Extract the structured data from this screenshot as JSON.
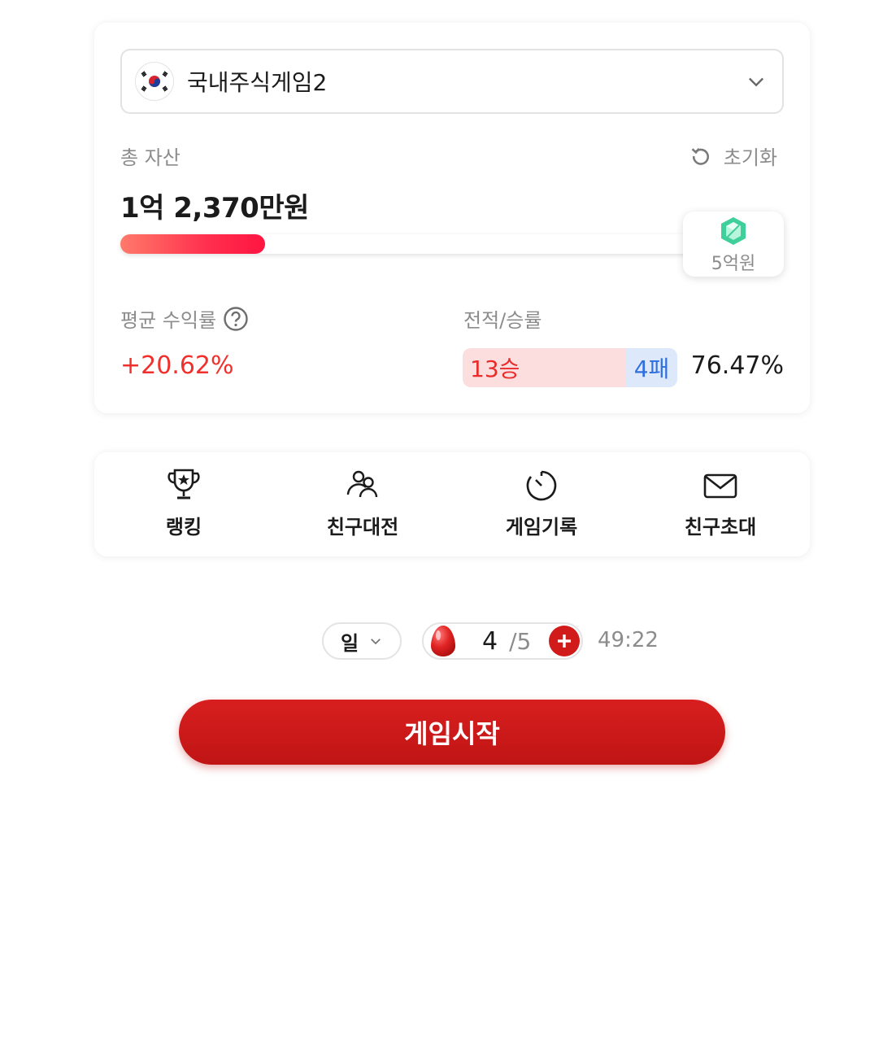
{
  "game": {
    "selected": "국내주식게임2",
    "flag_icon": "korea-flag-icon"
  },
  "assets": {
    "total_label": "총 자산",
    "reset_label": "초기화",
    "total_value": "1억 2,370만원",
    "progress_fraction": 0.2474,
    "goal_label": "5억원",
    "goal_icon": "gem-icon"
  },
  "stats": {
    "avg_label": "평균 수익률",
    "avg_value": "+20.62%",
    "record_label": "전적/승률",
    "wins": "13승",
    "losses": "4패",
    "win_rate": "76.47%"
  },
  "menu": [
    {
      "label": "랭킹",
      "icon": "trophy-icon"
    },
    {
      "label": "친구대전",
      "icon": "friends-icon"
    },
    {
      "label": "게임기록",
      "icon": "timer-icon"
    },
    {
      "label": "친구초대",
      "icon": "mail-icon"
    }
  ],
  "controls": {
    "mode": "일",
    "energy_current": "4",
    "energy_max": "/5",
    "timer": "49:22",
    "start_label": "게임시작"
  },
  "colors": {
    "accent_red": "#d11a1a",
    "win_red": "#ea2b2b",
    "loss_blue": "#2f6fde",
    "profit_red": "#f0302c"
  }
}
